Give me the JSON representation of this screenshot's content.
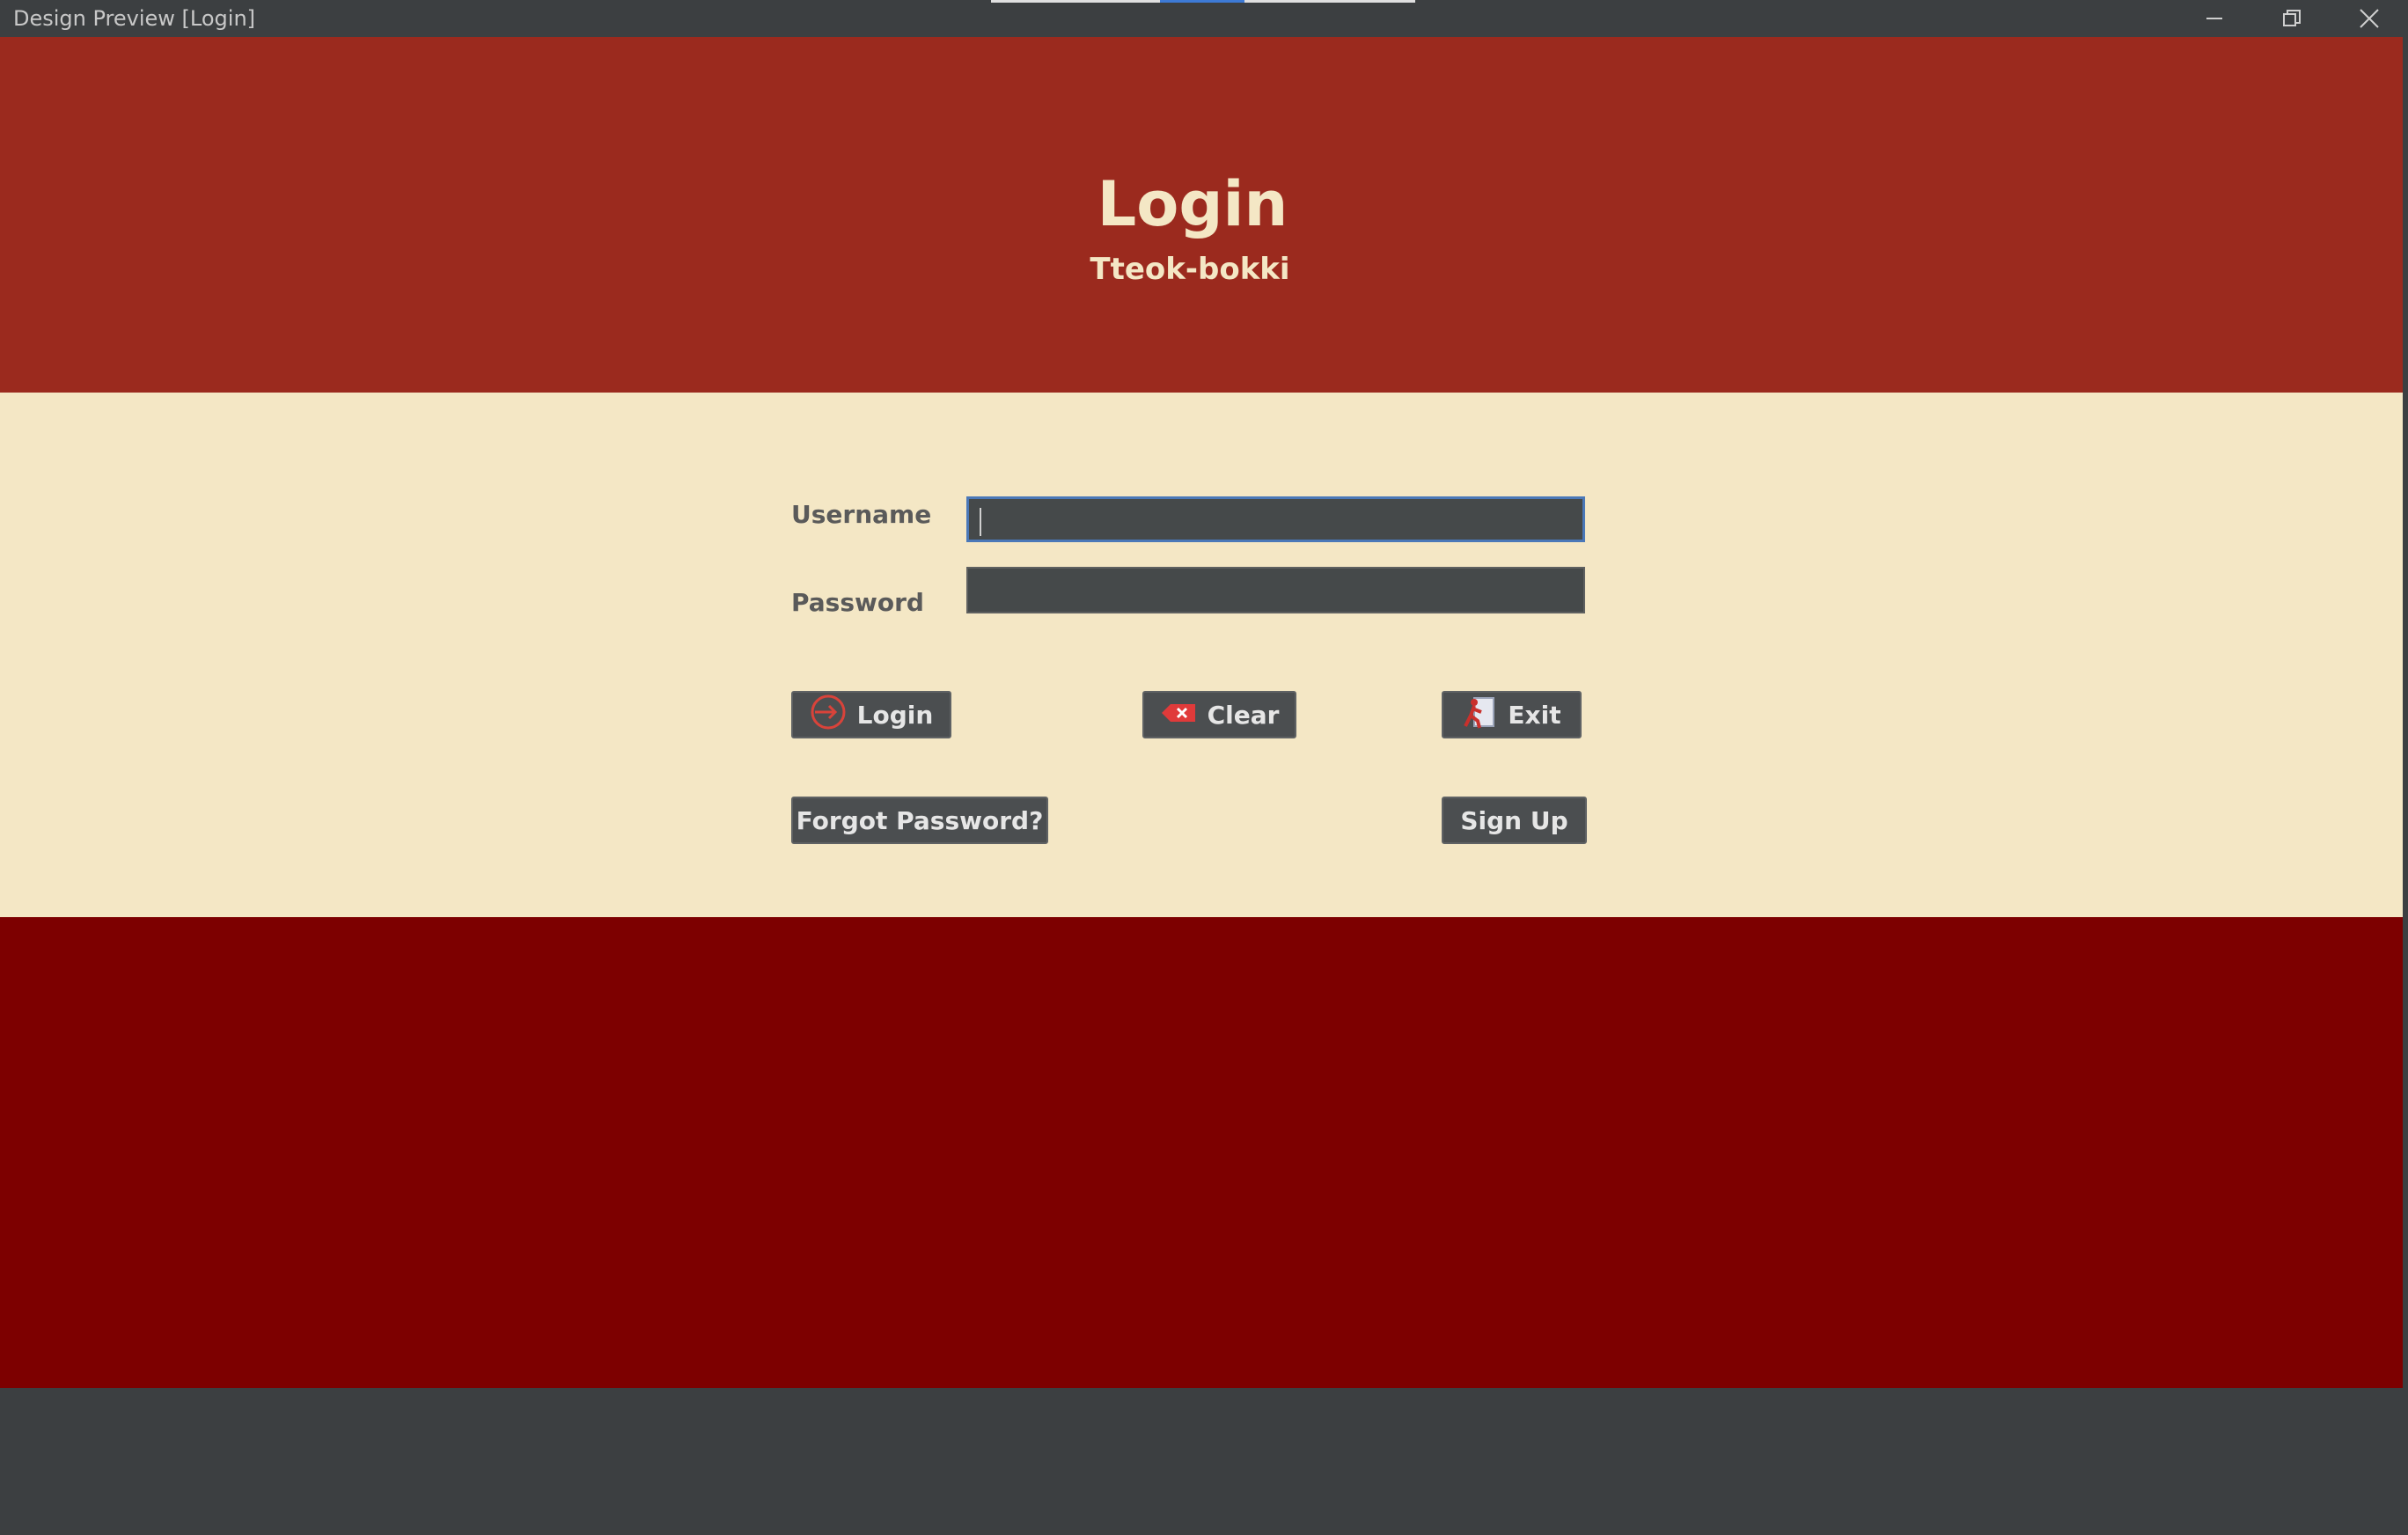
{
  "window": {
    "title": "Design Preview [Login]",
    "controls": {
      "minimize_icon": "minimize-icon",
      "restore_icon": "restore-icon",
      "close_icon": "close-icon"
    }
  },
  "header": {
    "title": "Login",
    "subtitle": "Tteok-bokki",
    "background": "#9b2a1e",
    "text_color": "#f4e7c5"
  },
  "form": {
    "background": "#f4e7c5",
    "username_label": "Username",
    "username_value": "",
    "password_label": "Password",
    "password_value": ""
  },
  "buttons": {
    "login": {
      "label": "Login",
      "icon": "login-icon"
    },
    "clear": {
      "label": "Clear",
      "icon": "clear-icon"
    },
    "exit": {
      "label": "Exit",
      "icon": "exit-icon"
    },
    "forgot": {
      "label": "Forgot Password?"
    },
    "signup": {
      "label": "Sign Up"
    }
  },
  "footer": {
    "background": "#7d0000"
  }
}
